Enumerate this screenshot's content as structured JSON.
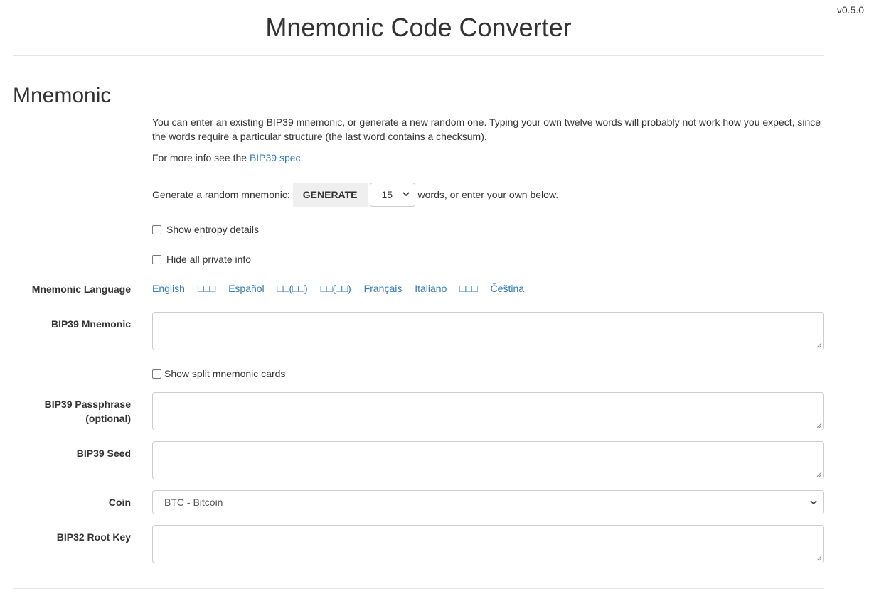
{
  "version": "v0.5.0",
  "header": {
    "title": "Mnemonic Code Converter"
  },
  "mnemonic_section": {
    "title": "Mnemonic",
    "intro": "You can enter an existing BIP39 mnemonic, or generate a new random one. Typing your own twelve words will probably not work how you expect, since the words require a particular structure (the last word contains a checksum).",
    "more_info_prefix": "For more info see the ",
    "more_info_link": "BIP39 spec",
    "more_info_suffix": ".",
    "generate_prefix": "Generate a random mnemonic:",
    "generate_button": "GENERATE",
    "word_count": "15",
    "generate_suffix": "words, or enter your own below.",
    "show_entropy": "Show entropy details",
    "hide_private": "Hide all private info",
    "language_label": "Mnemonic Language",
    "languages": [
      "English",
      "□□□",
      "Español",
      "□□(□□)",
      "□□(□□)",
      "Français",
      "Italiano",
      "□□□",
      "Čeština"
    ],
    "bip39_mnemonic_label": "BIP39 Mnemonic",
    "bip39_mnemonic_value": "",
    "show_split_cards": "Show split mnemonic cards",
    "passphrase_label_1": "BIP39 Passphrase",
    "passphrase_label_2": "(optional)",
    "passphrase_value": "",
    "seed_label": "BIP39 Seed",
    "seed_value": "",
    "coin_label": "Coin",
    "coin_value": "BTC - Bitcoin",
    "root_key_label": "BIP32 Root Key",
    "root_key_value": ""
  }
}
